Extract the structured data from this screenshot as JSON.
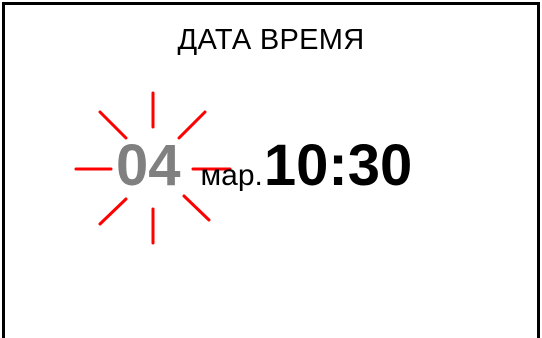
{
  "screen": {
    "title": "ДАТА ВРЕМЯ"
  },
  "datetime": {
    "day": "04",
    "month": "мар.",
    "time": "10:30",
    "editing_field": "day"
  },
  "colors": {
    "frame": "#000000",
    "background": "#ffffff",
    "editing_value": "#808080",
    "blink_indicator": "#ff0000",
    "text": "#000000"
  },
  "icons": {
    "editing_indicator": "blink-rays-icon"
  }
}
